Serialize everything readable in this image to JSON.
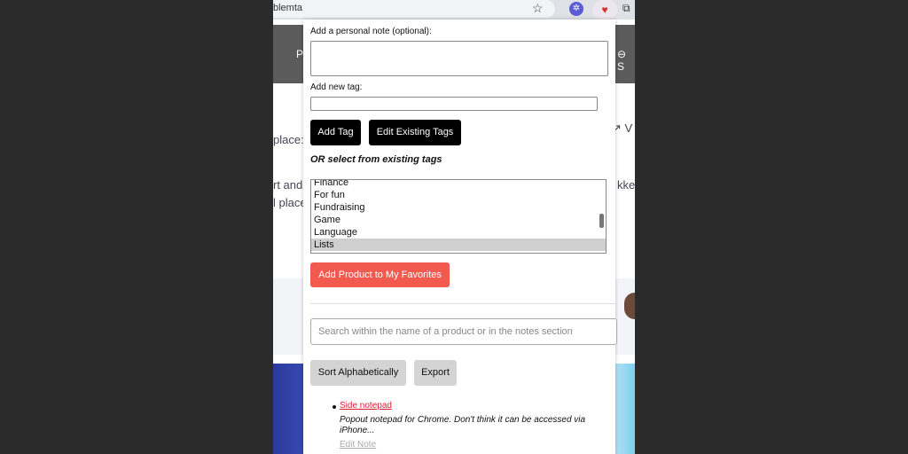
{
  "browser": {
    "url_fragment": "blemta",
    "star_glyph": "☆",
    "ext_puzzle_glyph": "✲",
    "ext_heart_glyph": "♥",
    "ext_window_glyph": "⧉"
  },
  "background_page": {
    "nav_left": "P",
    "nav_right": "⊖ S",
    "text_place": "place:",
    "text_row2": "rt and",
    "text_row3": "l place",
    "text_right1": "↗ V",
    "text_right2": "kke"
  },
  "popup": {
    "note_label": "Add a personal note (optional):",
    "tag_label": "Add new tag:",
    "add_tag_button": "Add Tag",
    "edit_tags_button": "Edit Existing Tags",
    "or_text": "OR select from existing tags",
    "tags": [
      "Finance",
      "For fun",
      "Fundraising",
      "Game",
      "Language",
      "Lists"
    ],
    "selected_tag": "Lists",
    "add_favorite_button": "Add Product to My Favorites",
    "search_placeholder": "Search within the name of a product or in the notes section",
    "sort_button": "Sort Alphabetically",
    "export_button": "Export",
    "favorite_item": {
      "title": "Side notepad",
      "description": "Popout notepad for Chrome. Don't think it can be accessed via iPhone...",
      "edit_link": "Edit Note"
    }
  },
  "colors": {
    "favorite_button": "#f25a50",
    "dark_button": "#000000",
    "link": "#dd2233"
  }
}
